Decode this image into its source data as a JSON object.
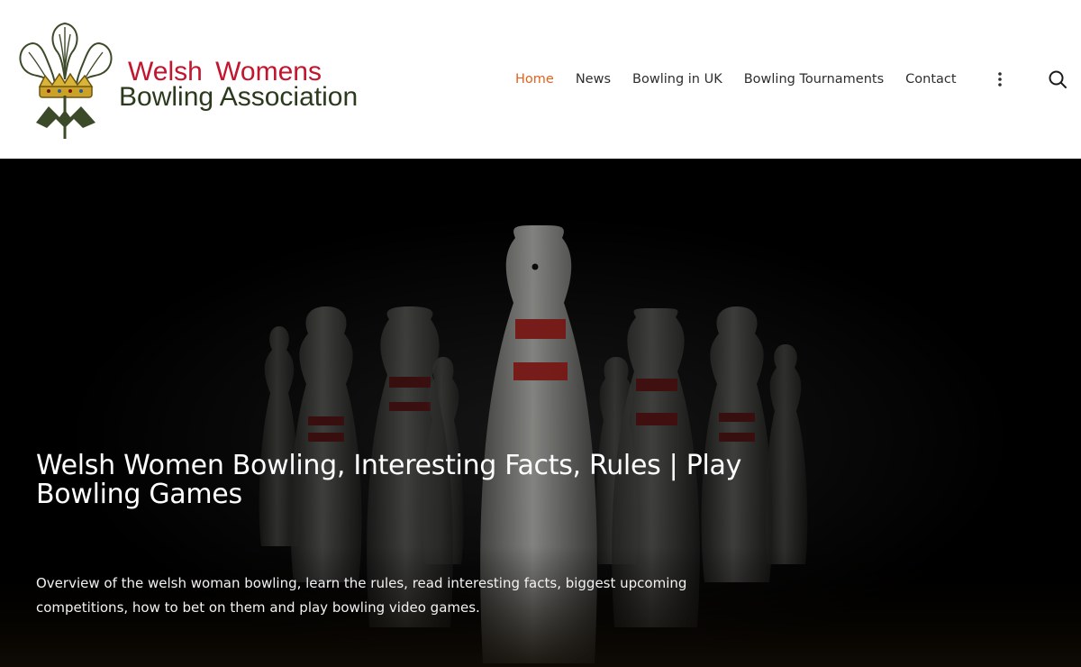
{
  "logo": {
    "line1": "Welsh Womens",
    "line2": "Bowling Association",
    "emblem_icon": "prince-of-wales-feathers-emblem-icon"
  },
  "nav": {
    "items": [
      {
        "label": "Home",
        "active": true
      },
      {
        "label": "News",
        "active": false
      },
      {
        "label": "Bowling in UK",
        "active": false
      },
      {
        "label": "Bowling Tournaments",
        "active": false
      },
      {
        "label": "Contact",
        "active": false
      }
    ],
    "more_icon": "vertical-dots-icon",
    "search_icon": "search-icon"
  },
  "hero": {
    "title": "Welsh Women Bowling, Interesting Facts, Rules | Play Bowling Games",
    "description": "Overview of the welsh woman bowling, learn the rules, read interesting facts, biggest upcoming competitions, how to bet on them and play bowling video games.",
    "background_image": "bowling-pins-dark-photo"
  },
  "colors": {
    "accent": "#e0631e",
    "logo_red": "#c2152e",
    "logo_green": "#2b3a1c",
    "nav_text": "#2e2e2e",
    "hero_bg": "#000000"
  }
}
